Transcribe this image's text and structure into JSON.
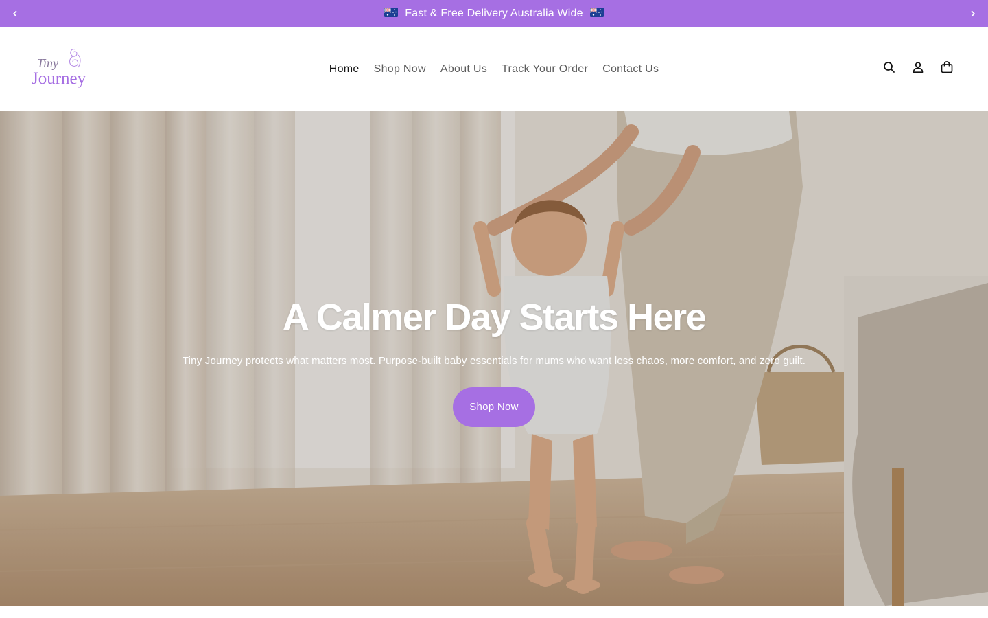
{
  "announcement": {
    "text": "Fast & Free Delivery Australia Wide",
    "prev_icon": "chevron-left-icon",
    "next_icon": "chevron-right-icon",
    "flag_icon": "australia-flag-icon"
  },
  "brand": {
    "logo_line1": "Tiny",
    "logo_line2": "Journey",
    "color_primary": "#a66fe3"
  },
  "nav": {
    "items": [
      {
        "label": "Home",
        "active": true
      },
      {
        "label": "Shop Now"
      },
      {
        "label": "About Us"
      },
      {
        "label": "Track Your Order"
      },
      {
        "label": "Contact Us"
      }
    ]
  },
  "header_icons": [
    "search-icon",
    "account-icon",
    "cart-icon"
  ],
  "hero": {
    "title": "A Calmer Day Starts Here",
    "subtitle": "Tiny Journey protects what matters most. Purpose-built baby essentials for mums who want less chaos, more comfort, and zero guilt.",
    "button_label": "Shop Now"
  }
}
